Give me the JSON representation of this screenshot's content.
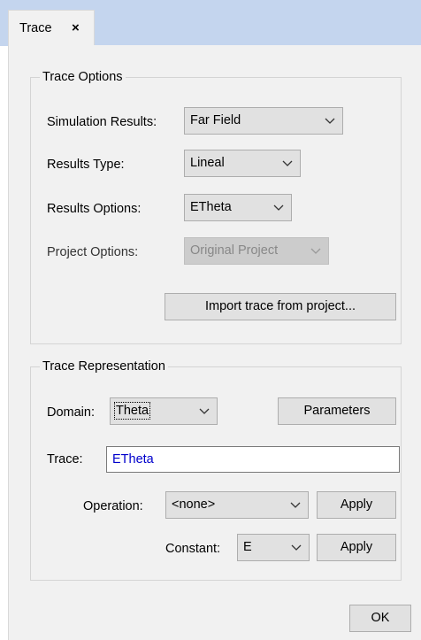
{
  "tab": {
    "label": "Trace",
    "close": "×"
  },
  "trace_options": {
    "title": "Trace Options",
    "simulation_results": {
      "label": "Simulation Results:",
      "value": "Far Field"
    },
    "results_type": {
      "label": "Results Type:",
      "value": "Lineal"
    },
    "results_options": {
      "label": "Results Options:",
      "value": "ETheta"
    },
    "project_options": {
      "label": "Project Options:",
      "value": "Original Project"
    },
    "import_button": "Import trace from project..."
  },
  "trace_representation": {
    "title": "Trace Representation",
    "domain": {
      "label": "Domain:",
      "value": "Theta"
    },
    "parameters_button": "Parameters",
    "trace": {
      "label": "Trace:",
      "value": "ETheta"
    },
    "operation": {
      "label": "Operation:",
      "value": "<none>",
      "apply": "Apply"
    },
    "constant": {
      "label": "Constant:",
      "value": "E",
      "apply": "Apply"
    }
  },
  "ok_button": "OK"
}
